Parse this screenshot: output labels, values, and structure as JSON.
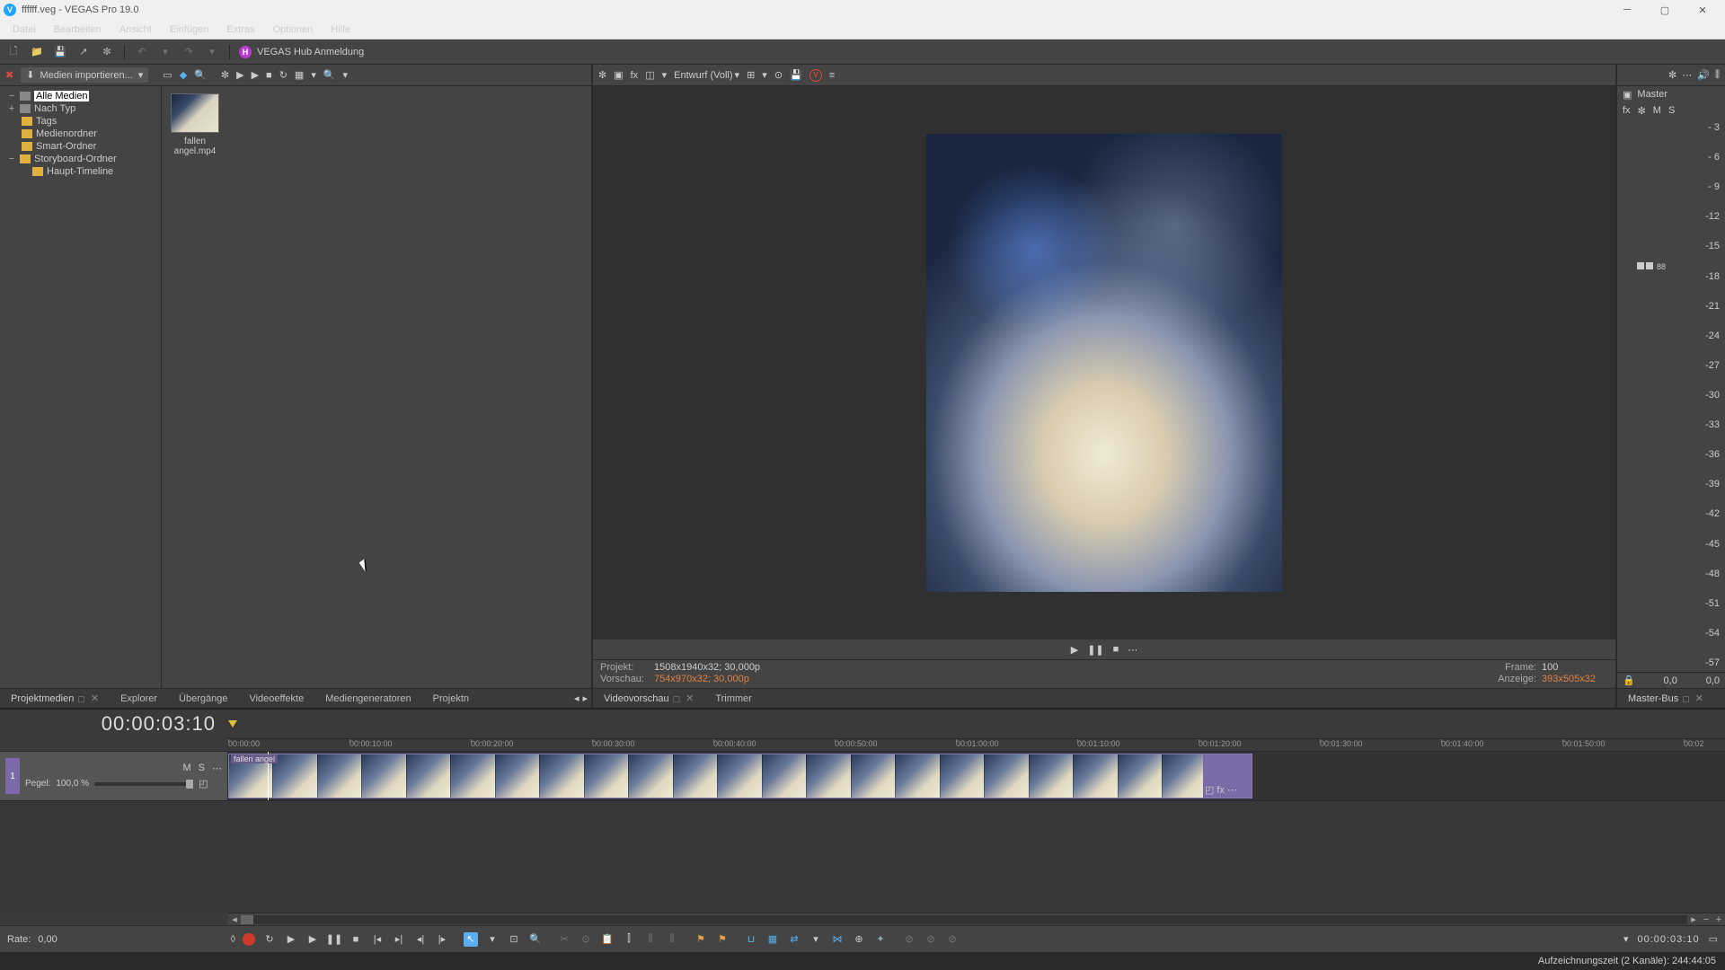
{
  "title": "ffffff.veg - VEGAS Pro 19.0",
  "appglyph": "V",
  "menu": [
    "Datei",
    "Bearbeiten",
    "Ansicht",
    "Einfügen",
    "Extras",
    "Optionen",
    "Hilfe"
  ],
  "hub": {
    "glyph": "H",
    "label": "VEGAS Hub Anmeldung"
  },
  "media": {
    "import_label": "Medien importieren...",
    "tree": [
      {
        "label": "Alle Medien",
        "sel": true,
        "exp": "−"
      },
      {
        "label": "Nach Typ",
        "exp": "+",
        "icon": "s"
      },
      {
        "label": "Tags",
        "indent": 1
      },
      {
        "label": "Medienordner",
        "indent": 1
      },
      {
        "label": "Smart-Ordner",
        "indent": 1
      },
      {
        "label": "Storyboard-Ordner",
        "exp": "−",
        "indent": 0
      },
      {
        "label": "Haupt-Timeline",
        "indent": 2
      }
    ],
    "thumb": {
      "name": "fallen angel.mp4"
    }
  },
  "preview": {
    "quality": "Entwurf (Voll)",
    "project_lbl": "Projekt:",
    "project_val": "1508x1940x32; 30,000p",
    "preview_lbl": "Vorschau:",
    "preview_val": "754x970x32; 30,000p",
    "frame_lbl": "Frame:",
    "frame_val": "100",
    "display_lbl": "Anzeige:",
    "display_val": "393x505x32"
  },
  "tabs_left": [
    {
      "label": "Projektmedien",
      "active": true,
      "pin": true,
      "close": true
    },
    {
      "label": "Explorer"
    },
    {
      "label": "Übergänge"
    },
    {
      "label": "Videoeffekte"
    },
    {
      "label": "Mediengeneratoren"
    },
    {
      "label": "Projektn"
    }
  ],
  "tabs_prev": [
    {
      "label": "Videovorschau",
      "active": true,
      "pin": true,
      "close": true
    },
    {
      "label": "Trimmer"
    }
  ],
  "tabs_master": {
    "label": "Master-Bus",
    "pin": true,
    "close": true
  },
  "master": {
    "title": "Master",
    "fx": "fx",
    "gear": "✼",
    "m": "M",
    "s": "S",
    "scale": [
      "- 3",
      "- 6",
      "- 9",
      "-12",
      "-15",
      "-18",
      "-21",
      "-24",
      "-27",
      "-30",
      "-33",
      "-36",
      "-39",
      "-42",
      "-45",
      "-48",
      "-51",
      "-54",
      "-57"
    ],
    "peakL": "0,0",
    "peakR": "0,0",
    "bars": "88"
  },
  "timeline": {
    "tc": "00:00:03:10",
    "ticks": [
      "00:00:00",
      "00:00:10:00",
      "00:00:20:00",
      "00:00:30:00",
      "00:00:40:00",
      "00:00:50:00",
      "00:01:00:00",
      "00:01:10:00",
      "00:01:20:00",
      "00:01:30:00",
      "00:01:40:00",
      "00:01:50:00",
      "00:02"
    ],
    "track": {
      "num": "1",
      "m": "M",
      "s": "S",
      "level_lbl": "Pegel:",
      "level_val": "100,0 %"
    },
    "clip": {
      "name": "fallen angel",
      "fx": "fx",
      "crop": "◰"
    }
  },
  "transport": {
    "rate_lbl": "Rate:",
    "rate_val": "0,00",
    "tc": "00:00:03:10"
  },
  "status": "Aufzeichnungszeit (2 Kanäle): 244:44:05"
}
